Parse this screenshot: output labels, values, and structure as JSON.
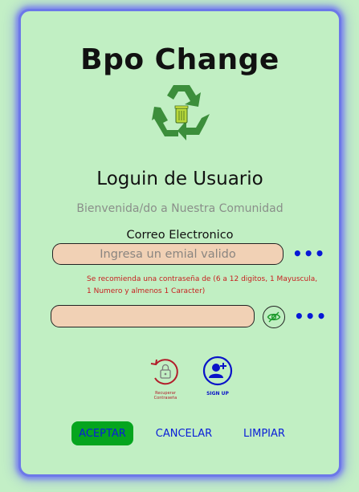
{
  "app": {
    "title": "Bpo Change"
  },
  "login": {
    "heading": "Loguin de Usuario",
    "welcome": "Bienvenida/do a Nuestra Comunidad",
    "email_label": "Correo Electronico",
    "email_placeholder": "Ingresa un emial valido",
    "email_value": "",
    "password_hint": "Se recomienda una contraseña de (6 a 12 digitos, 1 Mayuscula, 1 Numero y almenos 1 Caracter)",
    "password_value": "",
    "more_options": "•••"
  },
  "links": {
    "recover_label": "Recuperar Contraseña",
    "signup_label": "SIGN UP"
  },
  "actions": {
    "accept": "ACEPTAR",
    "cancel": "CANCELAR",
    "clear": "LIMPIAR"
  },
  "colors": {
    "background": "#c3efc6",
    "card_border": "#6c78e8",
    "input_fill": "#f1d1b5",
    "accent_blue": "#0a1ed8",
    "accept_green": "#05a51e",
    "hint_red": "#c81f1f",
    "logo_green": "#3c8e3b"
  },
  "icons": {
    "logo": "recycle-bin-icon",
    "eye": "eye-slash-icon",
    "recover": "lock-refresh-icon",
    "signup": "user-plus-icon"
  }
}
